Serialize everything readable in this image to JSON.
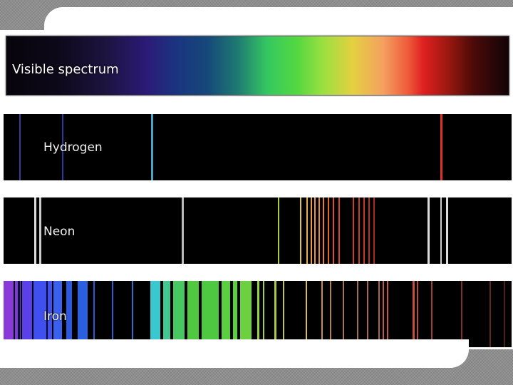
{
  "labels": {
    "visible": "Visible spectrum",
    "hydrogen": "Hydrogen",
    "neon": "Neon",
    "iron": "Iron"
  },
  "colors": {
    "strip_background": "#000000",
    "hydrogen_red": "#e0302a",
    "hydrogen_cyan": "#4aa6c8",
    "hydrogen_violet": "#3a3a9a",
    "neon_white": "#dddddd",
    "neon_orange": "#e8852a",
    "neon_red": "#d8452a"
  }
}
